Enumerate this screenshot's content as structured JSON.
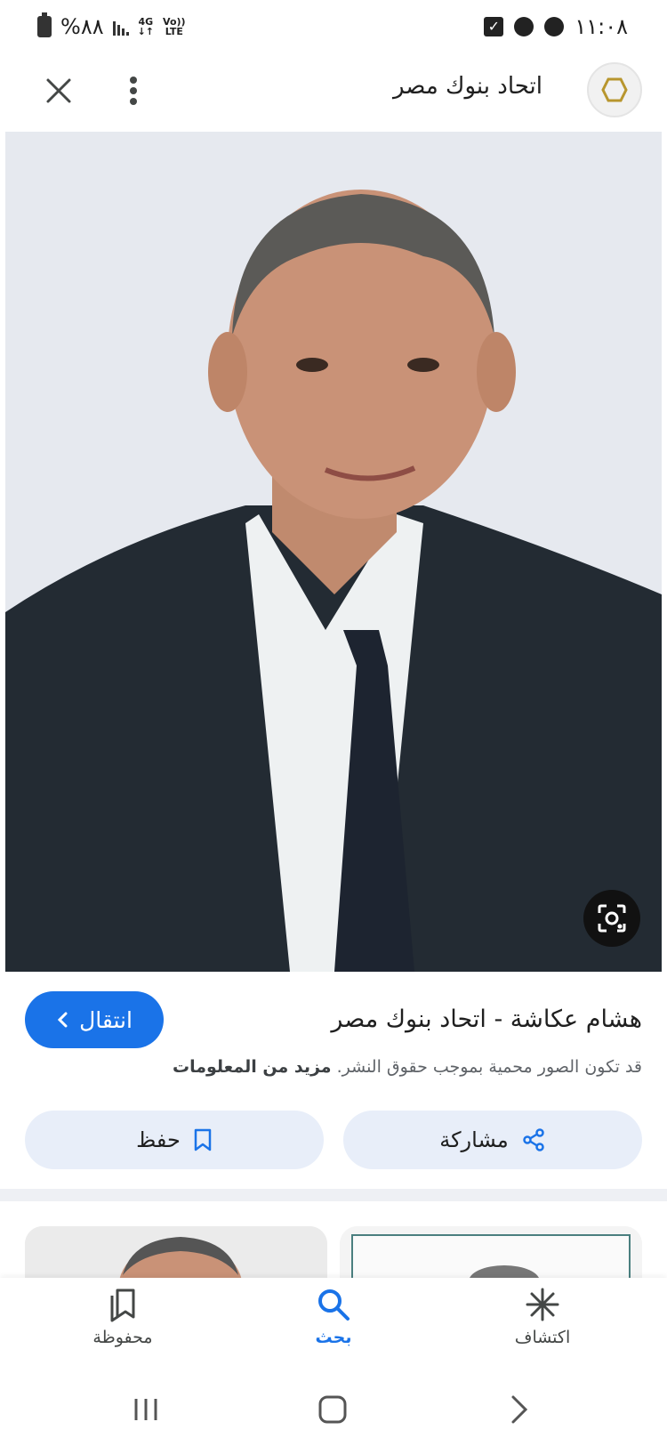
{
  "status_bar": {
    "time": "١١:٠٨",
    "battery": "%٨٨",
    "network_top": "4G",
    "lte_top": "Vo))",
    "lte_bottom": "LTE"
  },
  "header": {
    "title": "اتحاد بنوك مصر",
    "logo_icon": "hexagon-logo-icon",
    "more_icon": "more-vert-icon",
    "close_icon": "close-icon"
  },
  "image": {
    "lens_icon": "google-lens-icon",
    "background_color": "#e6e9ef"
  },
  "result": {
    "title": "هشام عكاشة - اتحاد بنوك مصر",
    "visit_label": "انتقال",
    "copyright_text": "قد تكون الصور محمية بموجب حقوق النشر.",
    "more_info": "مزيد من المعلومات"
  },
  "actions": {
    "share_label": "مشاركة",
    "save_label": "حفظ"
  },
  "bottom_nav": {
    "discover_label": "اكتشاف",
    "search_label": "بحث",
    "saved_label": "محفوظة"
  },
  "colors": {
    "accent": "#1a73e8",
    "action_bg": "#e8eef9"
  }
}
